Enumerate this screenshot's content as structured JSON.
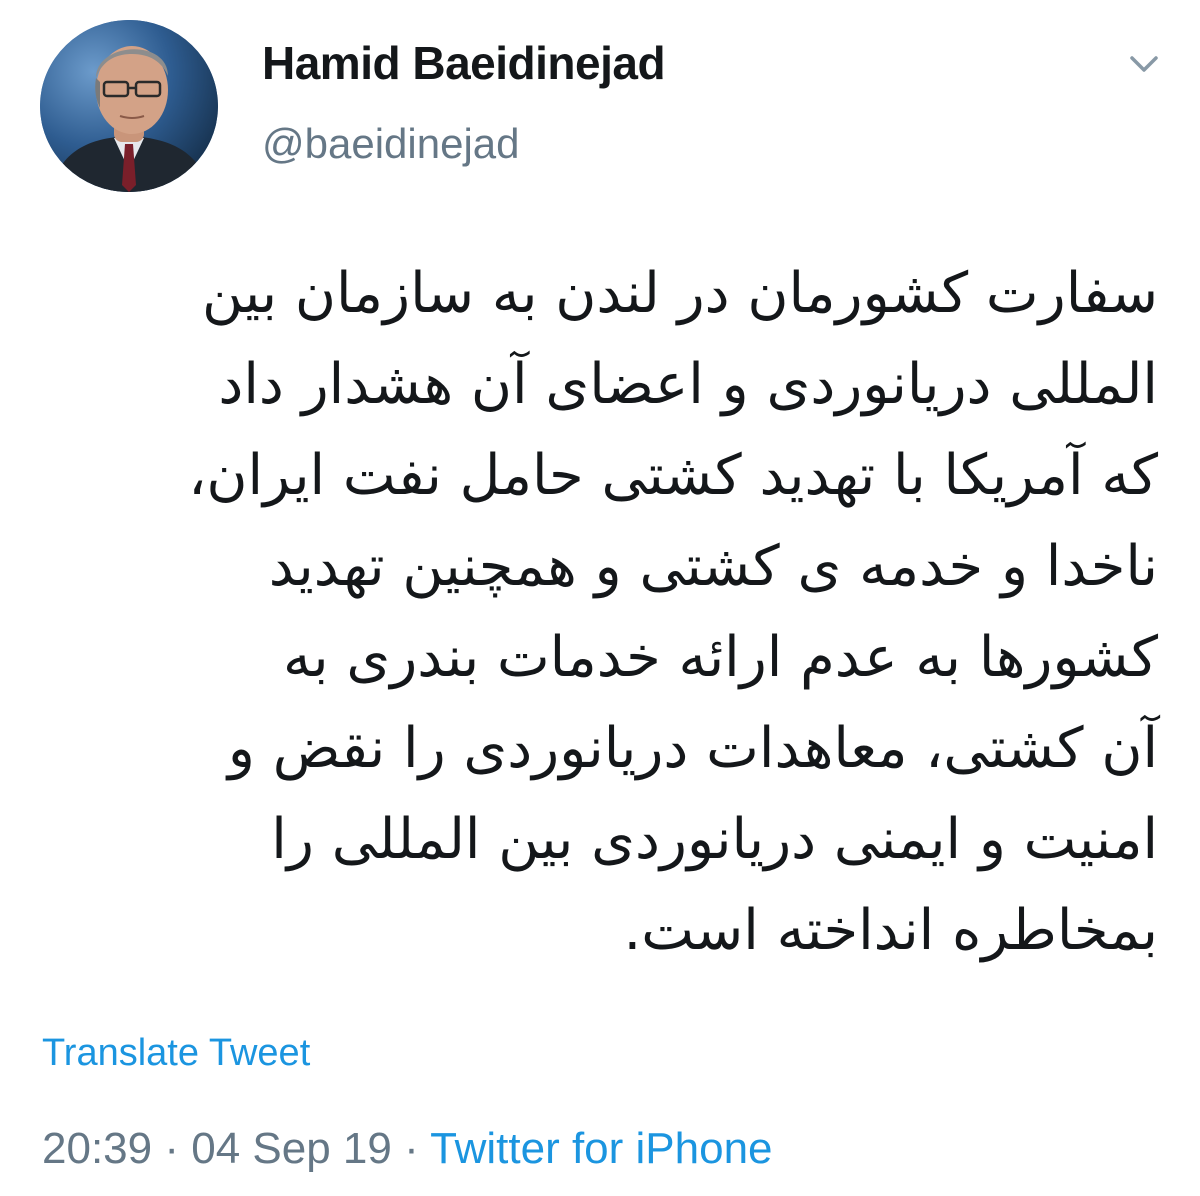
{
  "tweet": {
    "author": {
      "display_name": "Hamid Baeidinejad",
      "handle": "@baeidinejad",
      "avatar_icon": "profile-photo-icon"
    },
    "menu_icon": "chevron-down-icon",
    "text_lines": [
      "سفارت کشورمان در لندن به سازمان بین",
      "المللی دریانوردی و اعضای آن هشدار داد",
      "که آمریکا با تهدید کشتی حامل نفت ایران،",
      "ناخدا و خدمه ی کشتی و همچنین تهدید",
      "کشورها به عدم ارائه خدمات بندری به",
      "آن کشتی، معاهدات دریانوردی را نقض و",
      "امنیت و ایمنی دریانوردی بین المللی را",
      "بمخاطره انداخته است."
    ],
    "translate_label": "Translate Tweet",
    "time": "20:39",
    "separator": " · ",
    "date": "04 Sep 19",
    "source": "Twitter for iPhone"
  },
  "colors": {
    "link": "#1b95e0",
    "secondary_text": "#657786",
    "primary_text": "#14171a"
  }
}
